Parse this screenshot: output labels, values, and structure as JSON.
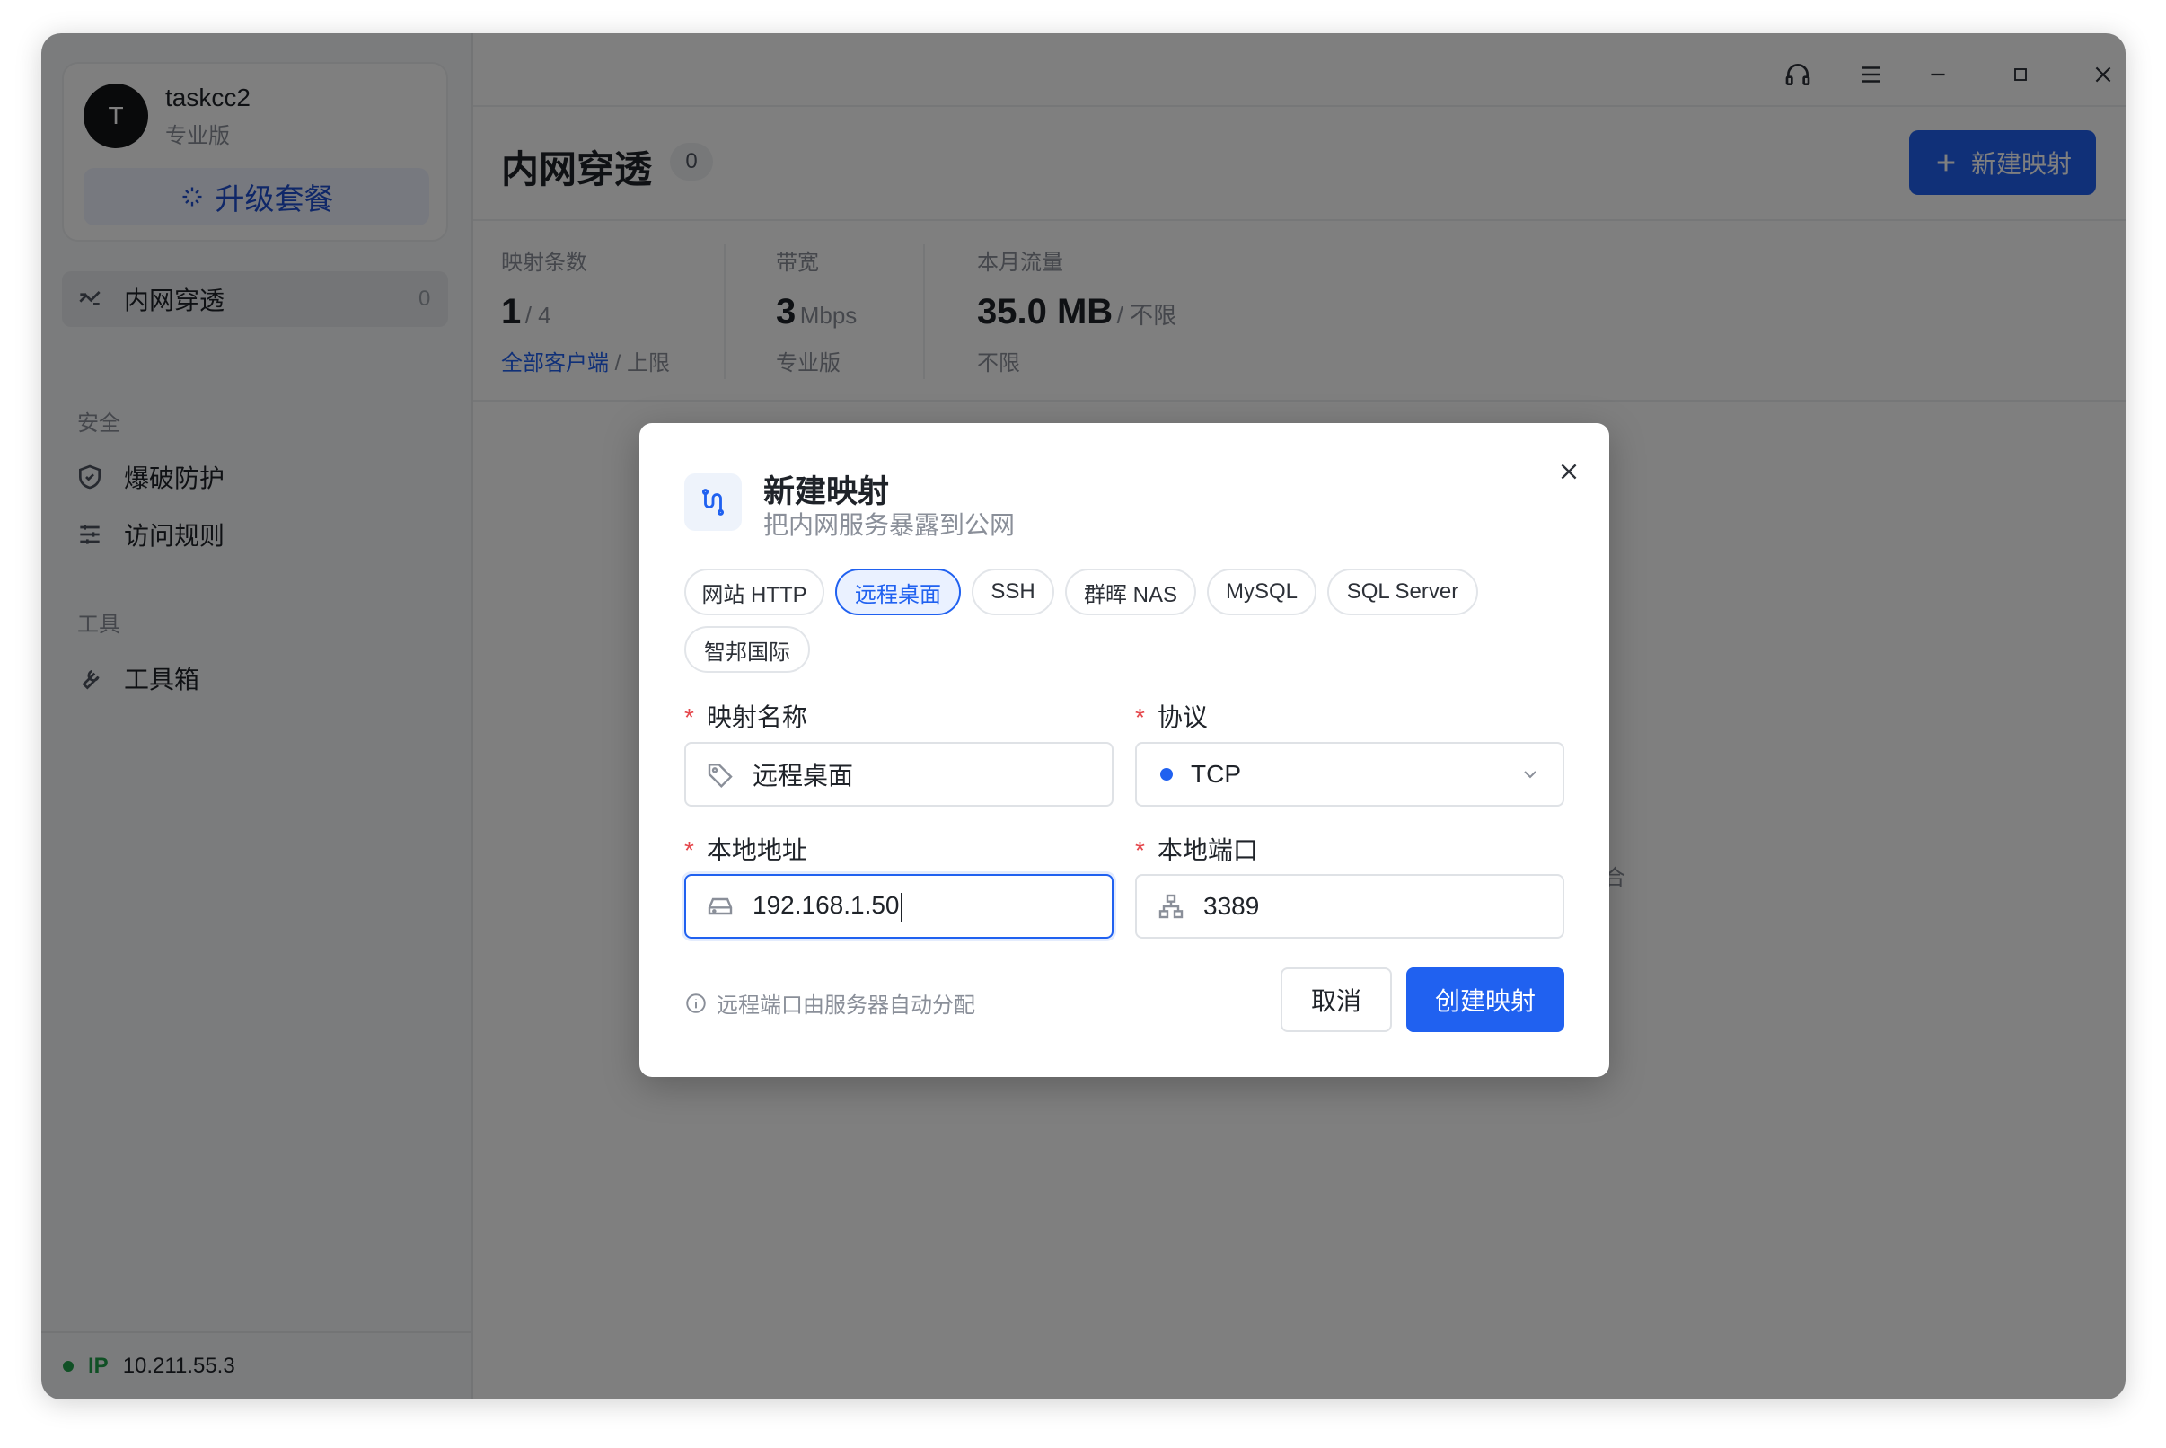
{
  "profile": {
    "avatar_letter": "T",
    "username": "taskcc2",
    "plan": "专业版",
    "upgrade_label": "升级套餐"
  },
  "sidebar": {
    "active_item": {
      "label": "内网穿透",
      "count": "0"
    },
    "section_security": "安全",
    "security_items": [
      {
        "label": "爆破防护",
        "icon": "shield-icon"
      },
      {
        "label": "访问规则",
        "icon": "sliders-icon"
      }
    ],
    "section_tools": "工具",
    "tools_items": [
      {
        "label": "工具箱",
        "icon": "wrench-icon"
      }
    ],
    "footer": {
      "ip_label": "IP",
      "ip_value": "10.211.55.3"
    }
  },
  "header": {
    "title": "内网穿透",
    "count": "0",
    "new_button_label": "新建映射"
  },
  "stats": [
    {
      "label": "映射条数",
      "value": "1",
      "unit": "/ 4",
      "sub_link": "全部客户端",
      "sub_text": " / 上限"
    },
    {
      "label": "带宽",
      "value": "3",
      "unit": " Mbps",
      "sub_link": "",
      "sub_text": "专业版"
    },
    {
      "label": "本月流量",
      "value": "35.0 MB",
      "unit": " / 不限",
      "sub_link": "",
      "sub_text": "不限"
    }
  ],
  "background_peek_text": "合",
  "dialog": {
    "title": "新建映射",
    "subtitle": "把内网服务暴露到公网",
    "presets": [
      "网站 HTTP",
      "远程桌面",
      "SSH",
      "群晖 NAS",
      "MySQL",
      "SQL Server",
      "智邦国际"
    ],
    "active_preset": "远程桌面",
    "fields": {
      "name": {
        "label": "映射名称",
        "value": "远程桌面"
      },
      "protocol": {
        "label": "协议",
        "value": "TCP"
      },
      "local_address": {
        "label": "本地地址",
        "value": "192.168.1.50"
      },
      "local_port": {
        "label": "本地端口",
        "value": "3389"
      }
    },
    "hint": "远程端口由服务器自动分配",
    "cancel_label": "取消",
    "create_label": "创建映射"
  },
  "colors": {
    "accent": "#2061f0",
    "required": "#e5484d",
    "online": "#21a04a"
  }
}
